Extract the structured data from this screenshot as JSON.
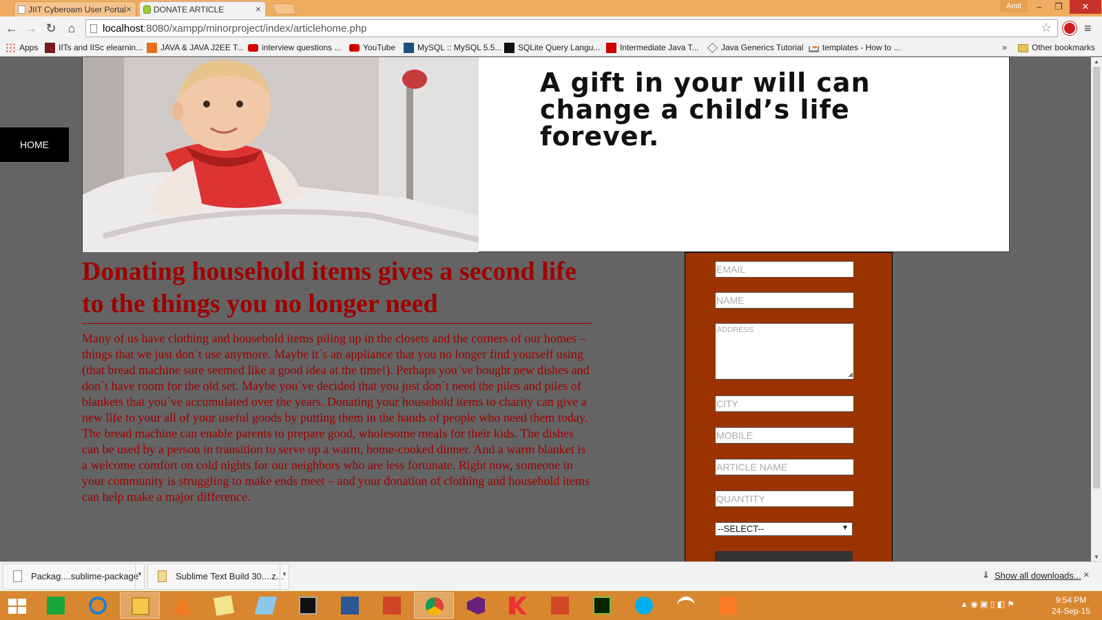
{
  "browser": {
    "tabs": [
      {
        "title": "JIIT Cyberoam User Portal",
        "active": false
      },
      {
        "title": "DONATE ARTICLE",
        "active": true
      }
    ],
    "user_name": "Amit",
    "url_host": "localhost",
    "url_rest": ":8080/xampp/minorproject/index/articlehome.php",
    "bookmarks": [
      {
        "label": "Apps",
        "icon": "apps-grid-icon"
      },
      {
        "label": "IITs and IISc elearnin...",
        "icon": "nptel-icon"
      },
      {
        "label": "JAVA & JAVA J2EE T...",
        "icon": "java-icon"
      },
      {
        "label": "interview questions ...",
        "icon": "youtube-icon"
      },
      {
        "label": "YouTube",
        "icon": "youtube-icon"
      },
      {
        "label": "MySQL :: MySQL 5.5...",
        "icon": "mysql-icon"
      },
      {
        "label": "SQLite Query Langu...",
        "icon": "sqlite-icon"
      },
      {
        "label": "Intermediate Java T...",
        "icon": "bookmark-red-icon"
      },
      {
        "label": "Java Generics Tutorial",
        "icon": "diamond-icon"
      },
      {
        "label": "templates - How to ...",
        "icon": "stackoverflow-icon"
      }
    ],
    "bookmarks_more": "»",
    "other_bookmarks": "Other bookmarks"
  },
  "page": {
    "nav_home": "HOME",
    "banner_tagline": "A gift in your will can change a child’s life forever.",
    "article_title": "Donating household items gives a second life to the things you no longer need",
    "article_body": "Many of us have clothing and household items piling up in the closets and the corners of our homes – things that we just don´t use anymore. Maybe it´s an appliance that you no longer find yourself using (that bread machine sure seemed like a good idea at the time!). Perhaps you´ve bought new dishes and don´t have room for the old set. Maybe you´ve decided that you just don´t need the piles and piles of blankets that you´ve accumulated over the years. Donating your household items to charity can give a new life to your all of your useful goods by putting them in the hands of people who need them today. The bread machine can enable parents to prepare good, wholesome meals for their kids. The dishes can be used by a person in transition to serve up a warm, home-cooked dinner. And a warm blanket is a welcome comfort on cold nights for our neighbors who are less fortunate. Right now, someone in your community is struggling to make ends meet – and your donation of clothing and household items can help make a major difference.",
    "form": {
      "email_placeholder": "EMAIL",
      "name_placeholder": "NAME",
      "address_placeholder": "ADDRESS",
      "city_placeholder": "CITY",
      "mobile_placeholder": "MOBILE",
      "article_name_placeholder": "ARTICLE NAME",
      "quantity_placeholder": "QUANTITY",
      "select_value": "--SELECT--"
    }
  },
  "downloads": {
    "items": [
      {
        "name": "Packag....sublime-package"
      },
      {
        "name": "Sublime Text Build 30....z..."
      }
    ],
    "show_all": "Show all downloads...",
    "close": "×"
  },
  "taskbar": {
    "time": "9:54 PM",
    "date": "24-Sep-15"
  }
}
